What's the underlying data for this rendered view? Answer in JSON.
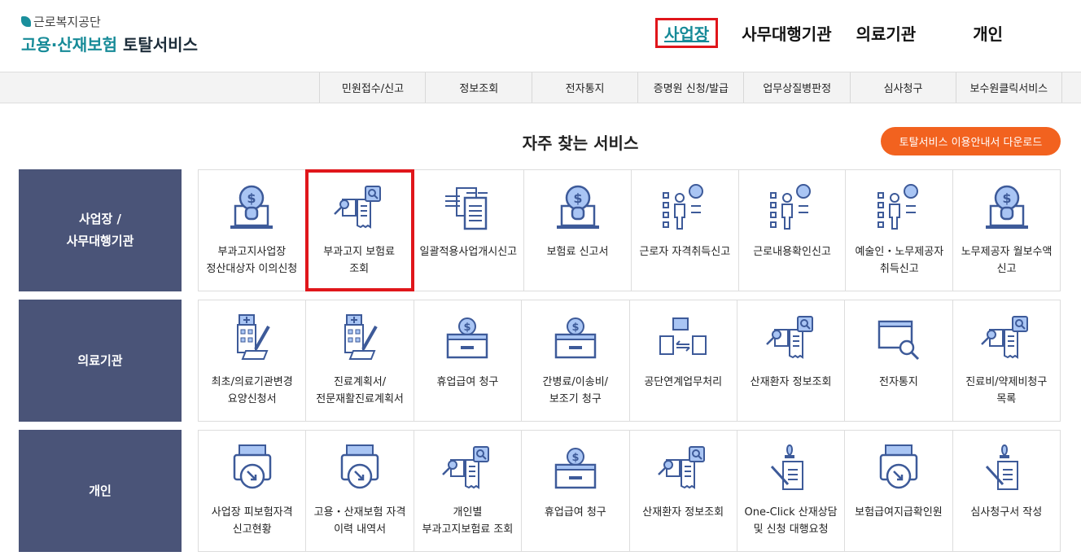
{
  "logo": {
    "org": "근로복지공단",
    "title_a": "고용·산재보험",
    "title_b": "토탈서비스"
  },
  "topnav": [
    "사업장",
    "사무대행기관",
    "의료기관",
    "개인"
  ],
  "subnav": [
    "민원접수/신고",
    "정보조회",
    "전자통지",
    "증명원 신청/발급",
    "업무상질병판정",
    "심사청구",
    "보수원클릭서비스"
  ],
  "section_title": "자주 찾는 서비스",
  "download_button": "토탈서비스 이용안내서 다운로드",
  "colors": {
    "accent": "#168a98",
    "panel": "#4a5478",
    "highlight": "#e0161b",
    "orange": "#f2621f"
  },
  "rows": [
    {
      "label": "사업장 /\n사무대행기관",
      "items": [
        {
          "text": "부과고지사업장 정산대상자 이의신청",
          "icon": "bulb"
        },
        {
          "text": "부과고지 보험료 조회",
          "icon": "search-doc"
        },
        {
          "text": "일괄적용사업개시신고",
          "icon": "transfer"
        },
        {
          "text": "보험료 신고서",
          "icon": "bulb"
        },
        {
          "text": "근로자 자격취득신고",
          "icon": "person-chart"
        },
        {
          "text": "근로내용확인신고",
          "icon": "person-chart"
        },
        {
          "text": "예술인・노무제공자 취득신고",
          "icon": "person-chart"
        },
        {
          "text": "노무제공자 월보수액 신고",
          "icon": "bulb"
        }
      ]
    },
    {
      "label": "의료기관",
      "items": [
        {
          "text": "최초/의료기관변경 요양신청서",
          "icon": "hospital"
        },
        {
          "text": "진료계획서/전문재활진료계획서",
          "icon": "hospital"
        },
        {
          "text": "휴업급여 청구",
          "icon": "box"
        },
        {
          "text": "간병료/이송비/보조기 청구",
          "icon": "box"
        },
        {
          "text": "공단연계업무처리",
          "icon": "exchange"
        },
        {
          "text": "산재환자 정보조회",
          "icon": "search-doc"
        },
        {
          "text": "전자통지",
          "icon": "parcel"
        },
        {
          "text": "진료비/약제비청구 목록",
          "icon": "search-doc"
        }
      ]
    },
    {
      "label": "개인",
      "items": [
        {
          "text": "사업장 피보험자격 신고현황",
          "icon": "printer"
        },
        {
          "text": "고용・산재보험 자격 이력 내역서",
          "icon": "printer"
        },
        {
          "text": "개인별 부과고지보험료 조회",
          "icon": "search-doc"
        },
        {
          "text": "휴업급여 청구",
          "icon": "box"
        },
        {
          "text": "산재환자 정보조회",
          "icon": "search-doc"
        },
        {
          "text": "One-Click 산재상담 및 신청 대행요청",
          "icon": "pen"
        },
        {
          "text": "보험급여지급확인원",
          "icon": "printer"
        },
        {
          "text": "심사청구서 작성",
          "icon": "pen"
        }
      ]
    }
  ]
}
